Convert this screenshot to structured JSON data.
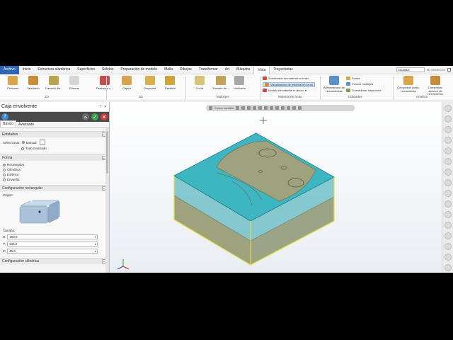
{
  "menu": {
    "items": [
      "Archivo",
      "Inicio",
      "Estructura alámbrica",
      "Superficies",
      "Sólidos",
      "Preparación de modelo",
      "Malla",
      "Dibujos",
      "Transformar",
      "Art",
      "Máquina",
      "Vista",
      "Trayectorias"
    ],
    "active_index": 0,
    "selected_index": 11,
    "combo_value": "Estándar",
    "user": "My Mastercam"
  },
  "ribbon": {
    "buttons": [
      {
        "label": "Contorno",
        "color": "#d9a54a"
      },
      {
        "label": "Taladrado",
        "color": "#c98c3a"
      },
      {
        "label": "Fresado din...",
        "color": "#b6a44e"
      },
      {
        "label": "Planear",
        "color": "#d6d6d6"
      },
      {
        "label": "Desbaste o...",
        "color": "#c44d4d"
      },
      {
        "label": "Cajera",
        "color": "#d6a24b"
      },
      {
        "label": "Proyectar",
        "color": "#d9b04f"
      },
      {
        "label": "Paralela",
        "color": "#cfa341"
      },
      {
        "label": "Curva",
        "color": "#d9c27a"
      },
      {
        "label": "Trazado de ...",
        "color": "#c0a25a"
      },
      {
        "label": "Unificada",
        "color": "#a8a8a8"
      },
      {
        "label": "Administrador de herramientas",
        "color": "#5d8fc8"
      },
      {
        "label": "Comprobar porta-herramienta",
        "color": "#d9a54a"
      },
      {
        "label": "Comprobar alcance de herramienta",
        "color": "#c98c3a"
      }
    ],
    "groups": [
      "2D",
      "3D",
      "Multiejes",
      "Material en bruto",
      "Utilidades",
      "Analizar"
    ],
    "stock_items": [
      "Sombreado de material en bruto",
      "Visualización de material en bruto",
      "Modelo de material en bruto"
    ],
    "utility_items": [
      "Sonda",
      "Vínculo multiejes",
      "Transformar trayectoria"
    ]
  },
  "panel": {
    "title": "Caja envolvente",
    "tabs": [
      "Básico",
      "Avanzado"
    ],
    "sections": {
      "entidades": {
        "title": "Entidades",
        "select_label": "Seleccionar:",
        "manual": "Manual",
        "all": "Todo mostrado"
      },
      "forma": {
        "title": "Forma",
        "options": [
          "Rectangular",
          "Cilíndrica",
          "Esférica",
          "Envuelta"
        ]
      },
      "rect": {
        "title": "Configuración rectangular",
        "origin_label": "Origen:",
        "size_label": "Tamaño:",
        "fields": [
          {
            "axis": "X:",
            "value": "100.0"
          },
          {
            "axis": "Y:",
            "value": "100.0"
          },
          {
            "axis": "Z:",
            "value": "45.0"
          }
        ]
      },
      "cyl": {
        "title": "Configuración cilíndrica"
      }
    }
  },
  "viewport": {
    "toolbar_label": "Cursor variable"
  },
  "colors": {
    "accent": "#2f66b3",
    "stock_top": "#3eb6c2",
    "stock_side": "#2fa5b1",
    "part": "#9ea27f",
    "outline": "#e8e03a"
  }
}
